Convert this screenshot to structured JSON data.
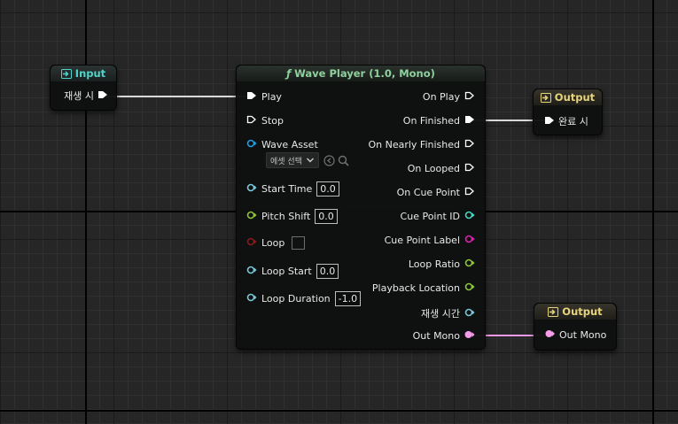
{
  "colors": {
    "exec": "#ffffff",
    "asset": "#1aa0e8",
    "float": "#77c9da",
    "bool": "#8a1a1a",
    "int": "#43d7c2",
    "string": "#e020b4",
    "pitch": "#8ec635",
    "audio": "#f59bea"
  },
  "input_node": {
    "title": "Input",
    "icon": "input-icon",
    "pin_label": "재생 시"
  },
  "output_node_1": {
    "title": "Output",
    "icon": "output-icon",
    "pin_label": "완료 시"
  },
  "output_node_2": {
    "title": "Output",
    "icon": "output-icon",
    "pin_label": "Out Mono"
  },
  "wave_player": {
    "title": "Wave Player (1.0, Mono)",
    "title_icon": "ƒ",
    "inputs": {
      "play": "Play",
      "stop": "Stop",
      "wave_asset": "Wave Asset",
      "wave_asset_dropdown": "에셋 선택",
      "start_time": "Start Time",
      "start_time_value": "0.0",
      "pitch_shift": "Pitch Shift",
      "pitch_shift_value": "0.0",
      "loop": "Loop",
      "loop_checked": false,
      "loop_start": "Loop Start",
      "loop_start_value": "0.0",
      "loop_duration": "Loop Duration",
      "loop_duration_value": "-1.0"
    },
    "outputs": {
      "on_play": "On Play",
      "on_finished": "On Finished",
      "on_nearly_finished": "On Nearly Finished",
      "on_looped": "On Looped",
      "on_cue_point": "On Cue Point",
      "cue_point_id": "Cue Point ID",
      "cue_point_label": "Cue Point Label",
      "loop_ratio": "Loop Ratio",
      "playback_location": "Playback Location",
      "playback_time": "재생 시간",
      "out_mono": "Out Mono"
    }
  }
}
